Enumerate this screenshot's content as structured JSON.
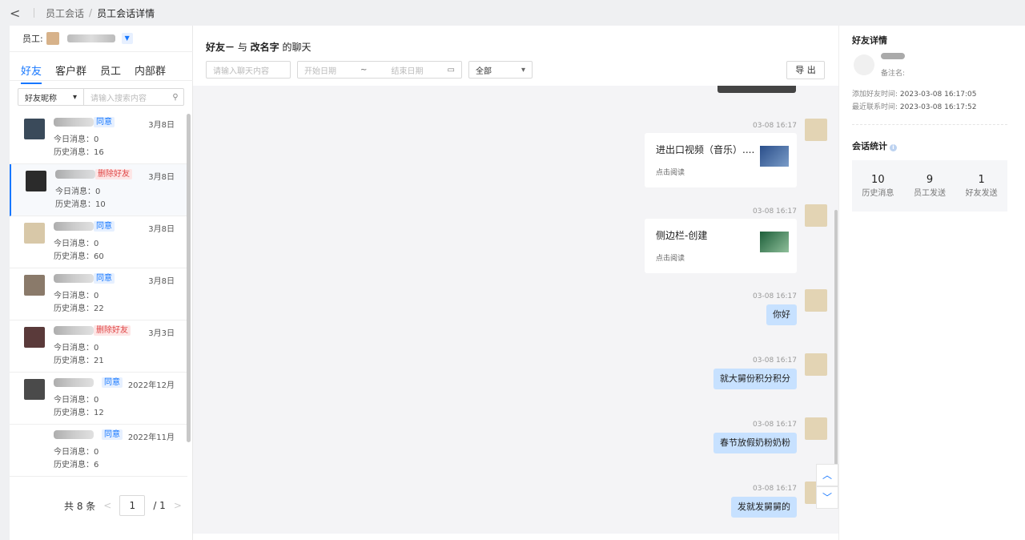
{
  "breadcrumb": {
    "back": "<",
    "parent": "员工会话",
    "sep": "/",
    "current": "员工会话详情"
  },
  "employee": {
    "label": "员工:",
    "name": ""
  },
  "tabs": [
    "好友",
    "客户群",
    "员工",
    "内部群"
  ],
  "filter": {
    "select": "好友昵称",
    "placeholder": "请输入搜索内容"
  },
  "friends": [
    {
      "tag": "同意",
      "tag_type": "ok",
      "date": "3月8日",
      "today": "今日消息：0",
      "history": "历史消息：16",
      "avatar": "#3a4a5a"
    },
    {
      "tag": "删除好友",
      "tag_type": "del",
      "date": "3月8日",
      "today": "今日消息：0",
      "history": "历史消息：10",
      "avatar": "#2b2b2b"
    },
    {
      "tag": "同意",
      "tag_type": "ok",
      "date": "3月8日",
      "today": "今日消息：0",
      "history": "历史消息：60",
      "avatar": "#d8c8a8"
    },
    {
      "tag": "同意",
      "tag_type": "ok",
      "date": "3月8日",
      "today": "今日消息：0",
      "history": "历史消息：22",
      "avatar": "#8a7a6a"
    },
    {
      "tag": "删除好友",
      "tag_type": "del",
      "date": "3月3日",
      "today": "今日消息：0",
      "history": "历史消息：21",
      "avatar": "#5a3a3a"
    },
    {
      "tag": "同意",
      "tag_type": "ok",
      "date": "2022年12月",
      "today": "今日消息：0",
      "history": "历史消息：12",
      "avatar": "#4a4a4a"
    },
    {
      "tag": "同意",
      "tag_type": "ok",
      "date": "2022年11月",
      "today": "今日消息：0",
      "history": "历史消息：6",
      "avatar": ""
    }
  ],
  "pager": {
    "total": "共 8 条",
    "prev": "<",
    "page": "1",
    "of": "/ 1",
    "next": ">"
  },
  "chat": {
    "title_prefix": "好友－",
    "title_mid": " 与 ",
    "title_suffix": "改名字",
    "title_end": " 的聊天",
    "search_placeholder": "请输入聊天内容",
    "start": "开始日期",
    "tilde": "~",
    "end": "结束日期",
    "type": "全部",
    "export": "导 出",
    "time": "03-08 16:17",
    "messages": [
      {
        "kind": "card",
        "text": "进出口视频（音乐）....",
        "read": "点击阅读"
      },
      {
        "kind": "card",
        "text": "侧边栏-创建",
        "read": "点击阅读"
      },
      {
        "kind": "text",
        "text": "你好"
      },
      {
        "kind": "text",
        "text": "就大舅份积分积分"
      },
      {
        "kind": "text",
        "text": "春节放假奶粉奶粉"
      },
      {
        "kind": "text",
        "text": "发就发舅舅的"
      }
    ]
  },
  "detail": {
    "title": "好友详情",
    "note": "备注名:",
    "add_time_label": "添加好友时间:",
    "add_time": "2023-03-08 16:17:05",
    "last_time_label": "最近联系时间:",
    "last_time": "2023-03-08 16:17:52",
    "stat_title": "会话统计",
    "stat_q": "i",
    "stats": [
      {
        "n": "10",
        "label": "历史消息"
      },
      {
        "n": "9",
        "label": "员工发送"
      },
      {
        "n": "1",
        "label": "好友发送"
      }
    ]
  },
  "colors": {
    "accent": "#1677ff",
    "bubble": "#c7e1ff",
    "danger": "#e04848"
  }
}
